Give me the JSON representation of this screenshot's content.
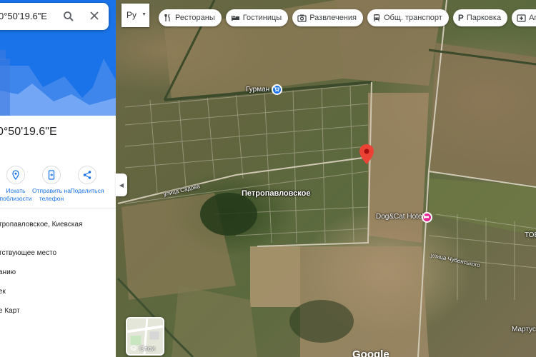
{
  "search": {
    "query": "0°50'19.6\"E"
  },
  "place": {
    "coords_title": "0°50'19.6\"E"
  },
  "actions": [
    {
      "label": "Искать поблизости"
    },
    {
      "label": "Отправить на телефон"
    },
    {
      "label": "Поделиться"
    }
  ],
  "info_rows": [
    "тропавловское, Киевская",
    "тствующее место",
    "анию",
    "ек",
    "е Карт"
  ],
  "language_button": {
    "label": "Ру"
  },
  "chips": [
    {
      "icon": "restaurant-icon",
      "label": "Рестораны"
    },
    {
      "icon": "hotel-icon",
      "label": "Гостиницы"
    },
    {
      "icon": "camera-icon",
      "label": "Развлечения"
    },
    {
      "icon": "transit-icon",
      "label": "Общ. транспорт"
    },
    {
      "icon": "parking-icon",
      "label": "Парковка"
    },
    {
      "icon": "pharmacy-icon",
      "label": "Аптеки"
    }
  ],
  "map": {
    "places": {
      "gurman": "Гурман",
      "town": "Петропавловское",
      "dogcat": "Dog&Cat Hotel",
      "street1": "улица Садова",
      "street2": "улица Чубенського",
      "tov": "ТОВ",
      "martus": "Мартус"
    },
    "layers_label": "Слои",
    "logo": "Google"
  },
  "colors": {
    "accent": "#1a73e8",
    "pin": "#ea4335",
    "hotel_poi": "#e52592"
  }
}
